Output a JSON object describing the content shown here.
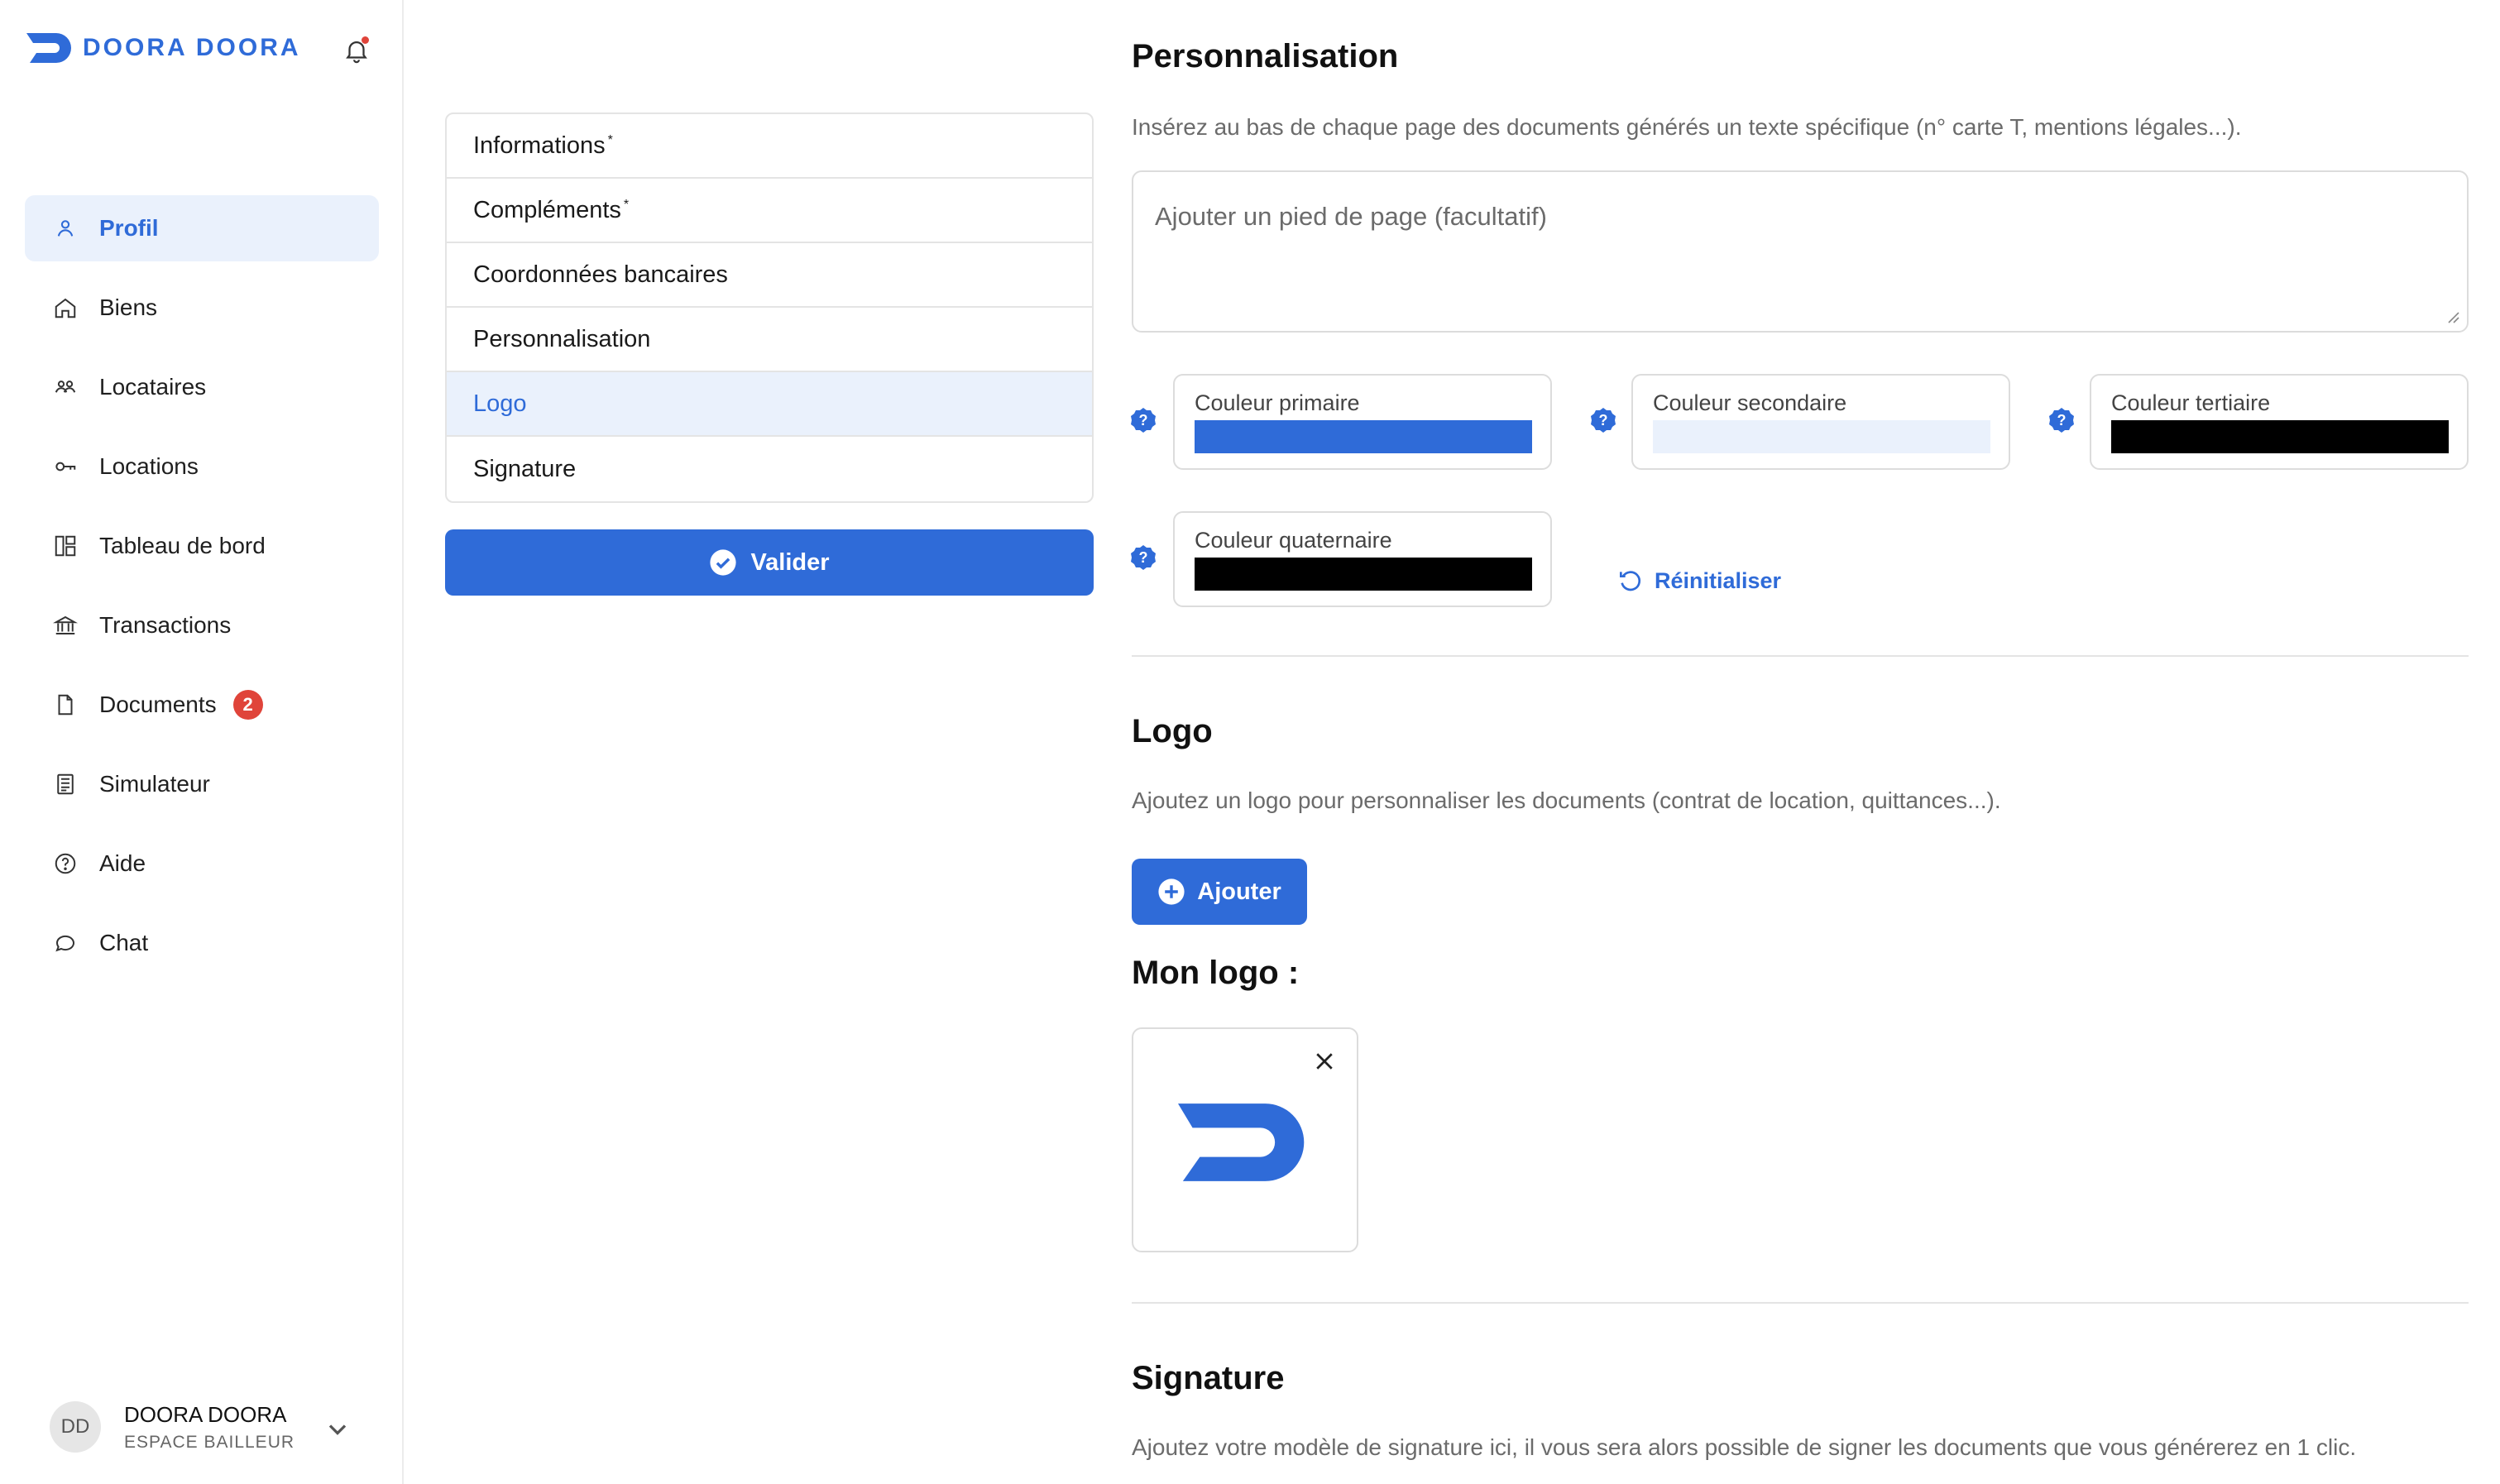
{
  "brand": {
    "name": "DOORA DOORA",
    "accent": "#2f6bd8"
  },
  "sidebar": {
    "items": [
      {
        "label": "Profil",
        "icon": "user-icon",
        "active": true
      },
      {
        "label": "Biens",
        "icon": "home-icon"
      },
      {
        "label": "Locataires",
        "icon": "users-icon"
      },
      {
        "label": "Locations",
        "icon": "key-icon"
      },
      {
        "label": "Tableau de bord",
        "icon": "dashboard-icon"
      },
      {
        "label": "Transactions",
        "icon": "bank-icon"
      },
      {
        "label": "Documents",
        "icon": "document-icon",
        "badge": "2"
      },
      {
        "label": "Simulateur",
        "icon": "calculator-icon"
      },
      {
        "label": "Aide",
        "icon": "help-circle-icon"
      },
      {
        "label": "Chat",
        "icon": "chat-icon"
      }
    ]
  },
  "user": {
    "initials": "DD",
    "name": "DOORA DOORA",
    "role": "ESPACE BAILLEUR"
  },
  "submenu": {
    "items": [
      {
        "label": "Informations",
        "required": "*"
      },
      {
        "label": "Compléments",
        "required": "*"
      },
      {
        "label": "Coordonnées bancaires"
      },
      {
        "label": "Personnalisation"
      },
      {
        "label": "Logo",
        "active": true
      },
      {
        "label": "Signature"
      }
    ],
    "validate_label": "Valider"
  },
  "personalisation": {
    "title": "Personnalisation",
    "description": "Insérez au bas de chaque page des documents générés un texte spécifique (n° carte T, mentions légales...).",
    "footer_placeholder": "Ajouter un pied de page (facultatif)",
    "colors": [
      {
        "label": "Couleur primaire",
        "value": "#2f6bd8"
      },
      {
        "label": "Couleur secondaire",
        "value": "#eaf1fc"
      },
      {
        "label": "Couleur tertiaire",
        "value": "#000000"
      },
      {
        "label": "Couleur quaternaire",
        "value": "#000000"
      }
    ],
    "reset_label": "Réinitialiser"
  },
  "logo": {
    "title": "Logo",
    "description": "Ajoutez un logo pour personnaliser les documents (contrat de location, quittances...).",
    "add_label": "Ajouter",
    "mine_label": "Mon logo :"
  },
  "signature": {
    "title": "Signature",
    "description": "Ajoutez votre modèle de signature ici, il vous sera alors possible de signer les documents que vous générerez en 1 clic."
  }
}
